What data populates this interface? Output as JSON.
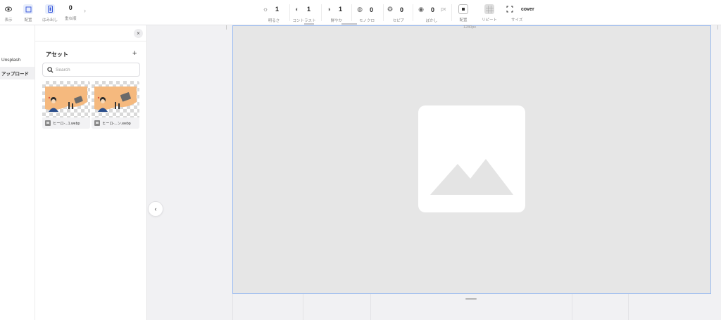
{
  "toolbar": {
    "left": [
      {
        "icon": "eye-icon",
        "label": "表示"
      },
      {
        "icon": "align-icon",
        "label": "配置"
      },
      {
        "icon": "overflow-icon",
        "label": "はみ出し"
      }
    ],
    "layer_order": {
      "value": "0",
      "label": "重ね順"
    },
    "adjustments": [
      {
        "icon": "brightness-icon",
        "value": "1",
        "label": "明るさ"
      },
      {
        "icon": "contrast-icon",
        "value": "1",
        "label": "コントラスト"
      },
      {
        "icon": "saturation-icon",
        "value": "1",
        "label": "鮮やか"
      },
      {
        "icon": "grayscale-icon",
        "value": "0",
        "label": "モノクロ"
      },
      {
        "icon": "sepia-icon",
        "value": "0",
        "label": "セピア"
      },
      {
        "icon": "blur-icon",
        "value": "0",
        "unit": "px",
        "label": "ぼかし"
      }
    ],
    "right": [
      {
        "icon": "position-icon",
        "label": "配置"
      },
      {
        "icon": "repeat-icon",
        "label": "リピート"
      },
      {
        "icon": "size-icon",
        "value": "cover",
        "label": "サイズ"
      }
    ]
  },
  "rail": {
    "items": [
      {
        "label": "Unsplash",
        "active": false
      },
      {
        "label": "アップロード",
        "active": true
      }
    ]
  },
  "assets": {
    "title": "アセット",
    "add": "+",
    "close": "×",
    "search_placeholder": "Search",
    "items": [
      {
        "name": "ヒーロ-...1.webp"
      },
      {
        "name": "ヒーロ-...ン.webp"
      }
    ]
  },
  "canvas": {
    "width_label": "1280px",
    "collapse": "‹"
  },
  "colors": {
    "accent": "#3b5bdb",
    "frame_border": "#9dbdf0",
    "frame_bg": "#e6e6e6",
    "thumb_blob": "#f5b97e"
  }
}
